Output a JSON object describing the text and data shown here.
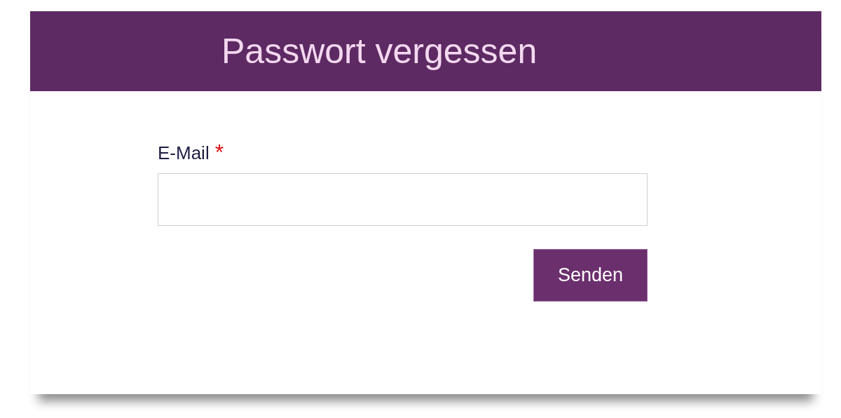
{
  "header": {
    "title": "Passwort vergessen"
  },
  "form": {
    "fields": [
      {
        "label": "E-Mail",
        "required_mark": "*"
      }
    ],
    "submit": "Senden"
  }
}
